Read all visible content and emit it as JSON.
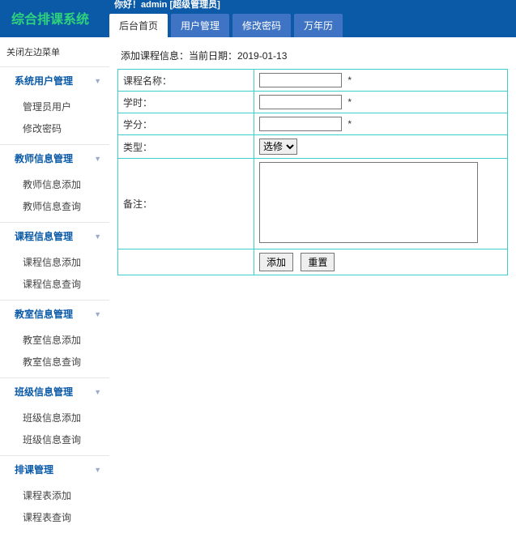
{
  "app_title": "综合排课系统",
  "greeting": "你好！admin  [超级管理员]",
  "tabs": [
    "后台首页",
    "用户管理",
    "修改密码",
    "万年历"
  ],
  "activeTab": 0,
  "close_menu_label": "关闭左边菜单",
  "sidebar": [
    {
      "title": "系统用户管理",
      "items": [
        "管理员用户",
        "修改密码"
      ]
    },
    {
      "title": "教师信息管理",
      "items": [
        "教师信息添加",
        "教师信息查询"
      ]
    },
    {
      "title": "课程信息管理",
      "items": [
        "课程信息添加",
        "课程信息查询"
      ]
    },
    {
      "title": "教室信息管理",
      "items": [
        "教室信息添加",
        "教室信息查询"
      ]
    },
    {
      "title": "班级信息管理",
      "items": [
        "班级信息添加",
        "班级信息查询"
      ]
    },
    {
      "title": "排课管理",
      "items": [
        "课程表添加",
        "课程表查询"
      ]
    }
  ],
  "form": {
    "heading": "添加课程信息：当前日期：2019-01-13",
    "fields": {
      "course_name": {
        "label": "课程名称：",
        "value": "",
        "required": "*"
      },
      "hours": {
        "label": "学时：",
        "value": "",
        "required": "*"
      },
      "credits": {
        "label": "学分：",
        "value": "",
        "required": "*"
      },
      "type": {
        "label": "类型：",
        "selected": "选修"
      },
      "remark": {
        "label": "备注：",
        "value": ""
      }
    },
    "buttons": {
      "submit": "添加",
      "reset": "重置"
    }
  }
}
